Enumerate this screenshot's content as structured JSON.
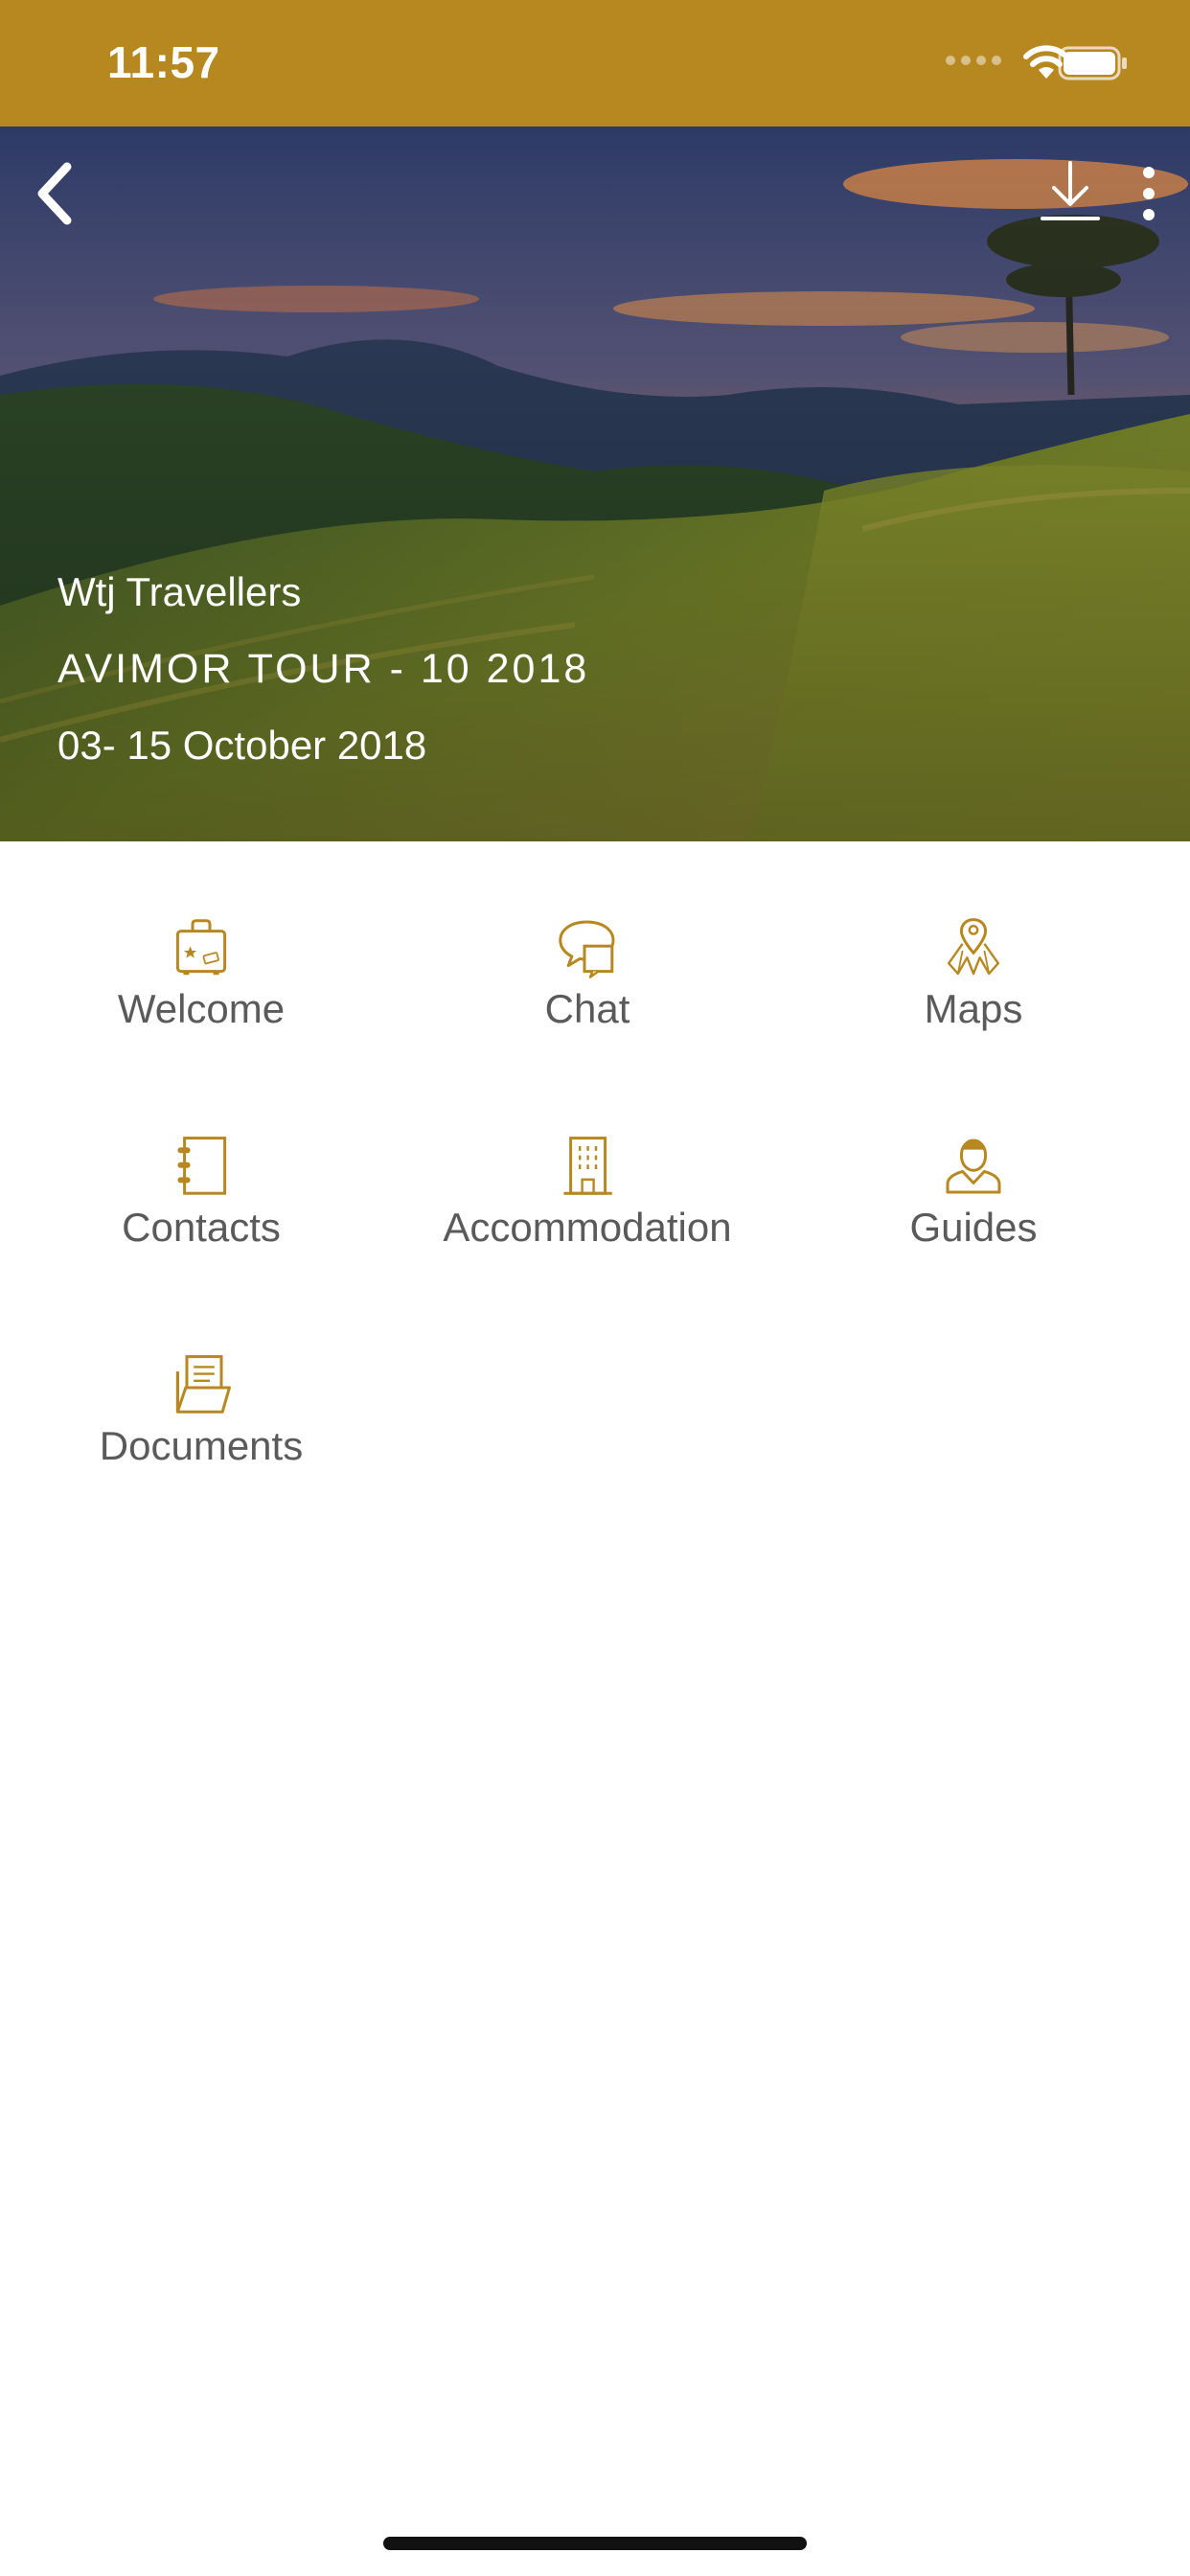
{
  "status_bar": {
    "time": "11:57",
    "background": "#b78820"
  },
  "header": {
    "back_icon": "chevron-left-icon",
    "download_icon": "download-icon",
    "more_icon": "more-vertical-icon"
  },
  "hero": {
    "organization": "Wtj Travellers",
    "tour_title": "AVIMOR TOUR - 10 2018",
    "dates": "03- 15 October 2018"
  },
  "menu": {
    "accent_color": "#b78820",
    "items": [
      {
        "label": "Welcome",
        "icon": "suitcase-icon"
      },
      {
        "label": "Chat",
        "icon": "chat-bubbles-icon"
      },
      {
        "label": "Maps",
        "icon": "map-pin-icon"
      },
      {
        "label": "Contacts",
        "icon": "address-book-icon"
      },
      {
        "label": "Accommodation",
        "icon": "building-icon"
      },
      {
        "label": "Guides",
        "icon": "person-icon"
      },
      {
        "label": "Documents",
        "icon": "folder-documents-icon"
      }
    ]
  }
}
